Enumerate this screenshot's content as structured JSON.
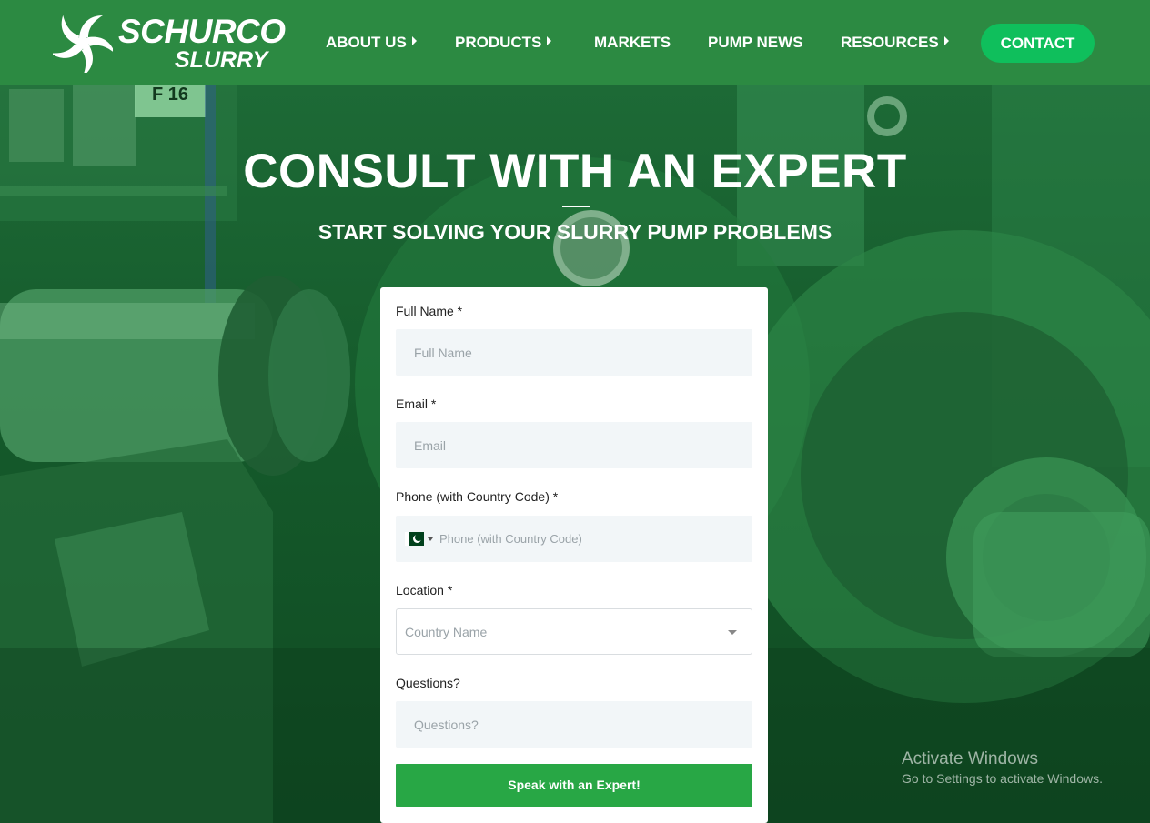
{
  "brand": {
    "name_top": "SCHURCO",
    "name_bottom": "SLURRY"
  },
  "nav": {
    "items": [
      {
        "label": "ABOUT US",
        "has_submenu": true
      },
      {
        "label": "PRODUCTS",
        "has_submenu": true
      },
      {
        "label": "MARKETS",
        "has_submenu": false
      },
      {
        "label": "PUMP NEWS",
        "has_submenu": false
      },
      {
        "label": "RESOURCES",
        "has_submenu": true
      }
    ],
    "contact_label": "CONTACT"
  },
  "hero": {
    "title": "CONSULT WITH AN EXPERT",
    "subtitle": "START SOLVING YOUR SLURRY PUMP PROBLEMS",
    "background_text": "F 16"
  },
  "form": {
    "full_name": {
      "label": "Full Name *",
      "placeholder": "Full Name"
    },
    "email": {
      "label": "Email *",
      "placeholder": "Email"
    },
    "phone": {
      "label": "Phone (with Country Code) *",
      "placeholder": "Phone (with Country Code)",
      "country_flag": "pakistan-flag-icon"
    },
    "location": {
      "label": "Location *",
      "selected": "Country Name"
    },
    "questions": {
      "label": "Questions?",
      "placeholder": "Questions?"
    },
    "submit_label": "Speak with an Expert!"
  },
  "watermark": {
    "title": "Activate Windows",
    "subtitle": "Go to Settings to activate Windows."
  },
  "colors": {
    "header_bg": "#2c8a42",
    "contact_button": "#0fbf5c",
    "submit_button": "#28a745",
    "field_bg": "#f2f6f8"
  }
}
